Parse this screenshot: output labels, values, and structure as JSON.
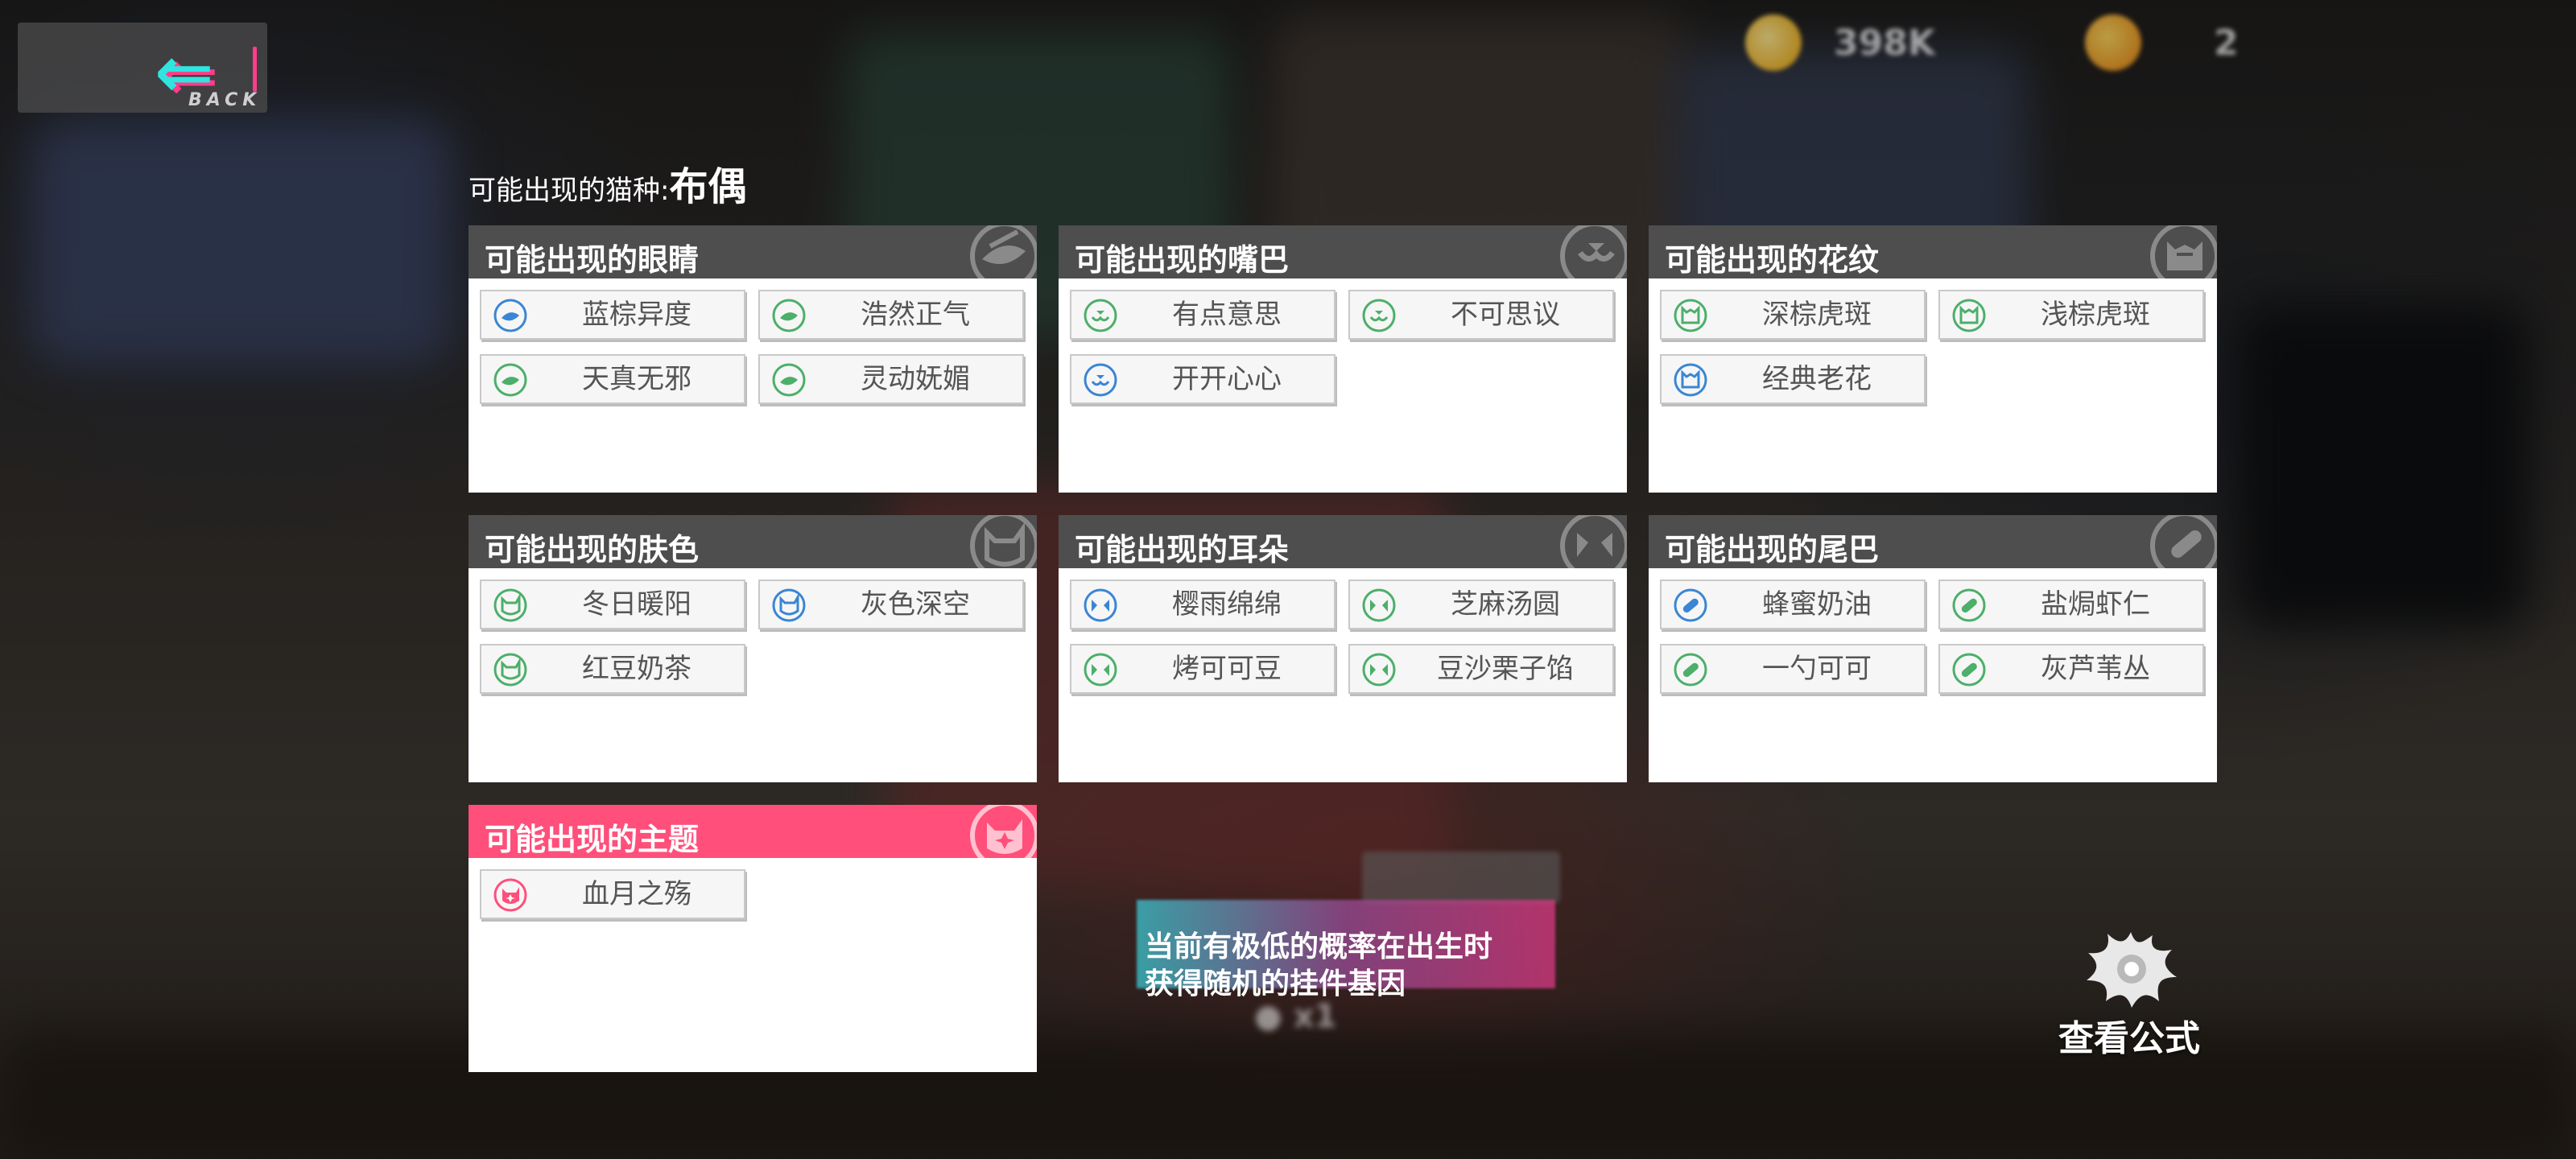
{
  "back": {
    "label": "BACK"
  },
  "currency": [
    {
      "value": "398K"
    },
    {
      "value": "2"
    }
  ],
  "breed": {
    "label": "可能出现的猫种:",
    "value": "布偶"
  },
  "panels": [
    {
      "title": "可能出现的眼睛",
      "icon": "eye-icon",
      "items": [
        {
          "label": "蓝棕异度",
          "color": "#3a86d4"
        },
        {
          "label": "浩然正气",
          "color": "#4caf6a"
        },
        {
          "label": "天真无邪",
          "color": "#4caf6a"
        },
        {
          "label": "灵动妩媚",
          "color": "#4caf6a"
        }
      ]
    },
    {
      "title": "可能出现的嘴巴",
      "icon": "mouth-icon",
      "items": [
        {
          "label": "有点意思",
          "color": "#4caf6a"
        },
        {
          "label": "不可思议",
          "color": "#4caf6a"
        },
        {
          "label": "开开心心",
          "color": "#3a86d4"
        }
      ]
    },
    {
      "title": "可能出现的花纹",
      "icon": "pattern-icon",
      "items": [
        {
          "label": "深棕虎斑",
          "color": "#4caf6a"
        },
        {
          "label": "浅棕虎斑",
          "color": "#4caf6a"
        },
        {
          "label": "经典老花",
          "color": "#3a86d4"
        }
      ]
    },
    {
      "title": "可能出现的肤色",
      "icon": "skin-icon",
      "items": [
        {
          "label": "冬日暖阳",
          "color": "#4caf6a"
        },
        {
          "label": "灰色深空",
          "color": "#3a86d4"
        },
        {
          "label": "红豆奶茶",
          "color": "#4caf6a"
        }
      ]
    },
    {
      "title": "可能出现的耳朵",
      "icon": "ear-icon",
      "items": [
        {
          "label": "樱雨绵绵",
          "color": "#3a86d4"
        },
        {
          "label": "芝麻汤圆",
          "color": "#4caf6a"
        },
        {
          "label": "烤可可豆",
          "color": "#4caf6a"
        },
        {
          "label": "豆沙栗子馅",
          "color": "#4caf6a"
        }
      ]
    },
    {
      "title": "可能出现的尾巴",
      "icon": "tail-icon",
      "items": [
        {
          "label": "蜂蜜奶油",
          "color": "#3a86d4"
        },
        {
          "label": "盐焗虾仁",
          "color": "#4caf6a"
        },
        {
          "label": "一勺可可",
          "color": "#4caf6a"
        },
        {
          "label": "灰芦苇丛",
          "color": "#4caf6a"
        }
      ]
    },
    {
      "title": "可能出现的主题",
      "icon": "theme-icon",
      "items": [
        {
          "label": "血月之殇",
          "color": "#ff4f7a"
        }
      ]
    }
  ],
  "notice": {
    "line1": "当前有极低的概率在出生时",
    "line2": "获得随机的挂件基因"
  },
  "formula": {
    "label": "查看公式"
  },
  "colors": {
    "header": "#4e4e4e",
    "theme_header": "#ff4f7a",
    "rare": "#3a86d4",
    "common": "#4caf6a"
  }
}
